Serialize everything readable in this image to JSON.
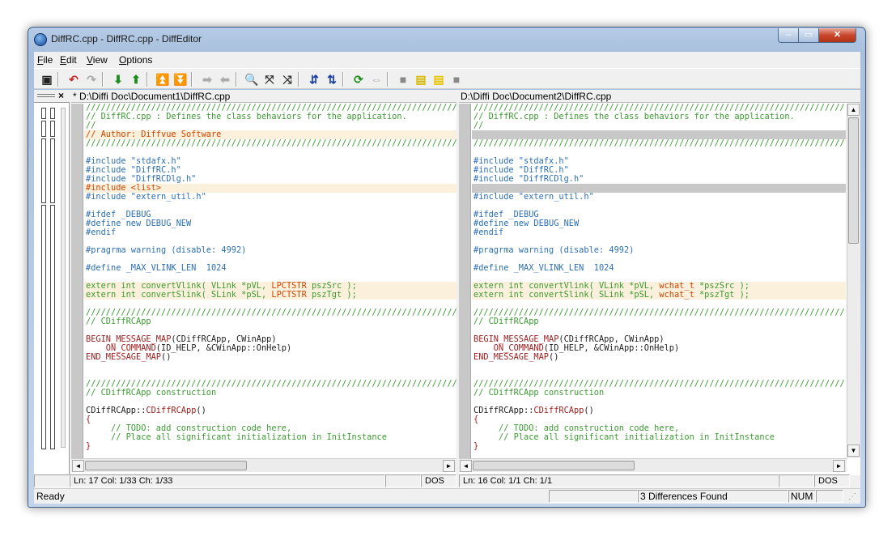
{
  "window": {
    "title": "DiffRC.cpp - DiffRC.cpp - DiffEditor",
    "min": "–",
    "max": "▭",
    "close": "✕"
  },
  "menu": [
    {
      "label": "File",
      "key": "F"
    },
    {
      "label": "Edit",
      "key": "E"
    },
    {
      "label": "View",
      "key": "V"
    },
    {
      "label": "Options",
      "key": "O"
    }
  ],
  "toolbar": {
    "icons": [
      {
        "name": "save-icon",
        "glyph": "▣",
        "color": "#222"
      },
      {
        "name": "undo-icon",
        "glyph": "↶",
        "color": "#c0302a"
      },
      {
        "name": "redo-icon",
        "glyph": "↷",
        "color": "#aaa"
      },
      {
        "name": "next-diff-icon",
        "glyph": "⬇",
        "color": "#1c8c1c"
      },
      {
        "name": "prev-diff-icon",
        "glyph": "⬆",
        "color": "#1c8c1c"
      },
      {
        "name": "first-diff-icon",
        "glyph": "⏫",
        "color": "#1c8c1c"
      },
      {
        "name": "last-diff-icon",
        "glyph": "⏬",
        "color": "#1c8c1c"
      },
      {
        "name": "copy-right-icon",
        "glyph": "➡",
        "color": "#aaa"
      },
      {
        "name": "copy-left-icon",
        "glyph": "⬅",
        "color": "#aaa"
      },
      {
        "name": "find-icon",
        "glyph": "🔍",
        "color": "#333"
      },
      {
        "name": "find-next-icon",
        "glyph": "⤧",
        "color": "#333"
      },
      {
        "name": "find-prev-icon",
        "glyph": "⤨",
        "color": "#333"
      },
      {
        "name": "sync-down-icon",
        "glyph": "⇵",
        "color": "#1a3fa8"
      },
      {
        "name": "sync-up-icon",
        "glyph": "⇅",
        "color": "#1a3fa8"
      },
      {
        "name": "refresh-icon",
        "glyph": "⟳",
        "color": "#1c8c1c"
      },
      {
        "name": "swap-icon",
        "glyph": "⇔",
        "color": "#aaa"
      },
      {
        "name": "pane-left-icon",
        "glyph": "■",
        "color": "#888"
      },
      {
        "name": "pane-both-icon",
        "glyph": "▤",
        "color": "#d8b800"
      },
      {
        "name": "pane-yellow-icon",
        "glyph": "▤",
        "color": "#e6c400"
      },
      {
        "name": "pane-right-icon",
        "glyph": "■",
        "color": "#888"
      }
    ]
  },
  "location_pane": {
    "close": "×"
  },
  "left": {
    "path": "* D:\\Diffi Doc\\Document1\\DiffRC.cpp",
    "status": "Ln: 17  Col: 1/33  Ch: 1/33",
    "mode": "DOS"
  },
  "right": {
    "path": "D:\\Diffi Doc\\Document2\\DiffRC.cpp",
    "status": "Ln: 16  Col: 1/1  Ch: 1/1",
    "mode": "DOS"
  },
  "left_lines": [
    [
      {
        "t": "//////////////////////////////////////////////////////////////////////////",
        "c": "c-com"
      }
    ],
    [
      {
        "t": "// DiffRC.cpp : Defines the class behaviors for the application.",
        "c": "c-com"
      }
    ],
    [
      {
        "t": "//",
        "c": "c-com"
      }
    ],
    [
      {
        "t": "// Author: Diffvue Software",
        "c": "c-hl"
      }
    ],
    [
      {
        "t": "//////////////////////////////////////////////////////////////////////////",
        "c": "c-com"
      }
    ],
    [],
    [
      {
        "t": "#include \"stdafx.h\"",
        "c": "c-pp"
      }
    ],
    [
      {
        "t": "#include \"DiffRC.h\"",
        "c": "c-pp"
      }
    ],
    [
      {
        "t": "#include \"DiffRCDlg.h\"",
        "c": "c-pp"
      }
    ],
    [
      {
        "t": "#include <list>",
        "c": "c-hl"
      }
    ],
    [
      {
        "t": "#include \"extern_util.h\"",
        "c": "c-pp"
      }
    ],
    [],
    [
      {
        "t": "#ifdef _DEBUG",
        "c": "c-pp"
      }
    ],
    [
      {
        "t": "#define new DEBUG_NEW",
        "c": "c-pp"
      }
    ],
    [
      {
        "t": "#endif",
        "c": "c-pp"
      }
    ],
    [],
    [
      {
        "t": "#pragrma warning (disable: 4992)",
        "c": "c-pp"
      }
    ],
    [],
    [
      {
        "t": "#define _MAX_VLINK_LEN  1024",
        "c": "c-pp"
      }
    ],
    [],
    [
      {
        "t": "extern int convertVlink( VLink *pVL, ",
        "c": "c-com"
      },
      {
        "t": "LPCTSTR",
        "c": "c-hl"
      },
      {
        "t": " pszSrc );",
        "c": "c-com"
      }
    ],
    [
      {
        "t": "extern int convertSlink( SLink *pSL, ",
        "c": "c-com"
      },
      {
        "t": "LPCTSTR",
        "c": "c-hl"
      },
      {
        "t": " pszTgt );",
        "c": "c-com"
      }
    ],
    [],
    [
      {
        "t": "//////////////////////////////////////////////////////////////////////////",
        "c": "c-com"
      }
    ],
    [
      {
        "t": "// CDiffRCApp",
        "c": "c-com"
      }
    ],
    [],
    [
      {
        "t": "BEGIN_MESSAGE_MAP",
        "c": "c-kw"
      },
      {
        "t": "(CDiffRCApp, CWinApp)",
        "c": "c-txt"
      }
    ],
    [
      {
        "t": "    ON_COMMAND",
        "c": "c-kw"
      },
      {
        "t": "(ID_HELP, &CWinApp::OnHelp)",
        "c": "c-txt"
      }
    ],
    [
      {
        "t": "END_MESSAGE_MAP",
        "c": "c-kw"
      },
      {
        "t": "()",
        "c": "c-txt"
      }
    ],
    [],
    [],
    [
      {
        "t": "//////////////////////////////////////////////////////////////////////////",
        "c": "c-com"
      }
    ],
    [
      {
        "t": "// CDiffRCApp construction",
        "c": "c-com"
      }
    ],
    [],
    [
      {
        "t": "CDiffRCApp::",
        "c": "c-txt"
      },
      {
        "t": "CDiffRCApp",
        "c": "c-kw"
      },
      {
        "t": "()",
        "c": "c-txt"
      }
    ],
    [
      {
        "t": "{",
        "c": "c-kw"
      }
    ],
    [
      {
        "t": "     // TODO: add construction code here,",
        "c": "c-com"
      }
    ],
    [
      {
        "t": "     // Place all significant initialization in InitInstance",
        "c": "c-com"
      }
    ],
    [
      {
        "t": "}",
        "c": "c-kw"
      }
    ]
  ],
  "right_lines": [
    [
      {
        "t": "//////////////////////////////////////////////////////////////////////////",
        "c": "c-com"
      }
    ],
    [
      {
        "t": "// DiffRC.cpp : Defines the class behaviors for the application.",
        "c": "c-com"
      }
    ],
    [
      {
        "t": "//",
        "c": "c-com"
      }
    ],
    [],
    [
      {
        "t": "//////////////////////////////////////////////////////////////////////////",
        "c": "c-com"
      }
    ],
    [],
    [
      {
        "t": "#include \"stdafx.h\"",
        "c": "c-pp"
      }
    ],
    [
      {
        "t": "#include \"DiffRC.h\"",
        "c": "c-pp"
      }
    ],
    [
      {
        "t": "#include \"DiffRCDlg.h\"",
        "c": "c-pp"
      }
    ],
    [],
    [
      {
        "t": "#include \"extern_util.h\"",
        "c": "c-pp"
      }
    ],
    [],
    [
      {
        "t": "#ifdef _DEBUG",
        "c": "c-pp"
      }
    ],
    [
      {
        "t": "#define new DEBUG_NEW",
        "c": "c-pp"
      }
    ],
    [
      {
        "t": "#endif",
        "c": "c-pp"
      }
    ],
    [],
    [
      {
        "t": "#pragrma warning (disable: 4992)",
        "c": "c-pp"
      }
    ],
    [],
    [
      {
        "t": "#define _MAX_VLINK_LEN  1024",
        "c": "c-pp"
      }
    ],
    [],
    [
      {
        "t": "extern int convertVlink( VLink *pVL, ",
        "c": "c-com"
      },
      {
        "t": "wchat_t",
        "c": "c-hl"
      },
      {
        "t": " *pszSrc );",
        "c": "c-com"
      }
    ],
    [
      {
        "t": "extern int convertSlink( SLink *pSL, ",
        "c": "c-com"
      },
      {
        "t": "wchat_t",
        "c": "c-hl"
      },
      {
        "t": " *pszTgt );",
        "c": "c-com"
      }
    ],
    [],
    [
      {
        "t": "//////////////////////////////////////////////////////////////////////////",
        "c": "c-com"
      }
    ],
    [
      {
        "t": "// CDiffRCApp",
        "c": "c-com"
      }
    ],
    [],
    [
      {
        "t": "BEGIN_MESSAGE_MAP",
        "c": "c-kw"
      },
      {
        "t": "(CDiffRCApp, CWinApp)",
        "c": "c-txt"
      }
    ],
    [
      {
        "t": "    ON_COMMAND",
        "c": "c-kw"
      },
      {
        "t": "(ID_HELP, &CWinApp::OnHelp)",
        "c": "c-txt"
      }
    ],
    [
      {
        "t": "END_MESSAGE_MAP",
        "c": "c-kw"
      },
      {
        "t": "()",
        "c": "c-txt"
      }
    ],
    [],
    [],
    [
      {
        "t": "//////////////////////////////////////////////////////////////////////////",
        "c": "c-com"
      }
    ],
    [
      {
        "t": "// CDiffRCApp construction",
        "c": "c-com"
      }
    ],
    [],
    [
      {
        "t": "CDiffRCApp::",
        "c": "c-txt"
      },
      {
        "t": "CDiffRCApp",
        "c": "c-kw"
      },
      {
        "t": "()",
        "c": "c-txt"
      }
    ],
    [
      {
        "t": "{",
        "c": "c-kw"
      }
    ],
    [
      {
        "t": "     // TODO: add construction code here,",
        "c": "c-com"
      }
    ],
    [
      {
        "t": "     // Place all significant initialization in InitInstance",
        "c": "c-com"
      }
    ],
    [
      {
        "t": "}",
        "c": "c-kw"
      }
    ]
  ],
  "line_states": {
    "changed": [
      3,
      9,
      20,
      21
    ],
    "gap_right": [
      3,
      9
    ]
  },
  "status": {
    "ready": "Ready",
    "diffs": "3 Differences Found",
    "num": "NUM"
  },
  "scroll": {
    "left": "◄",
    "right": "►",
    "up": "▲",
    "down": "▼"
  }
}
